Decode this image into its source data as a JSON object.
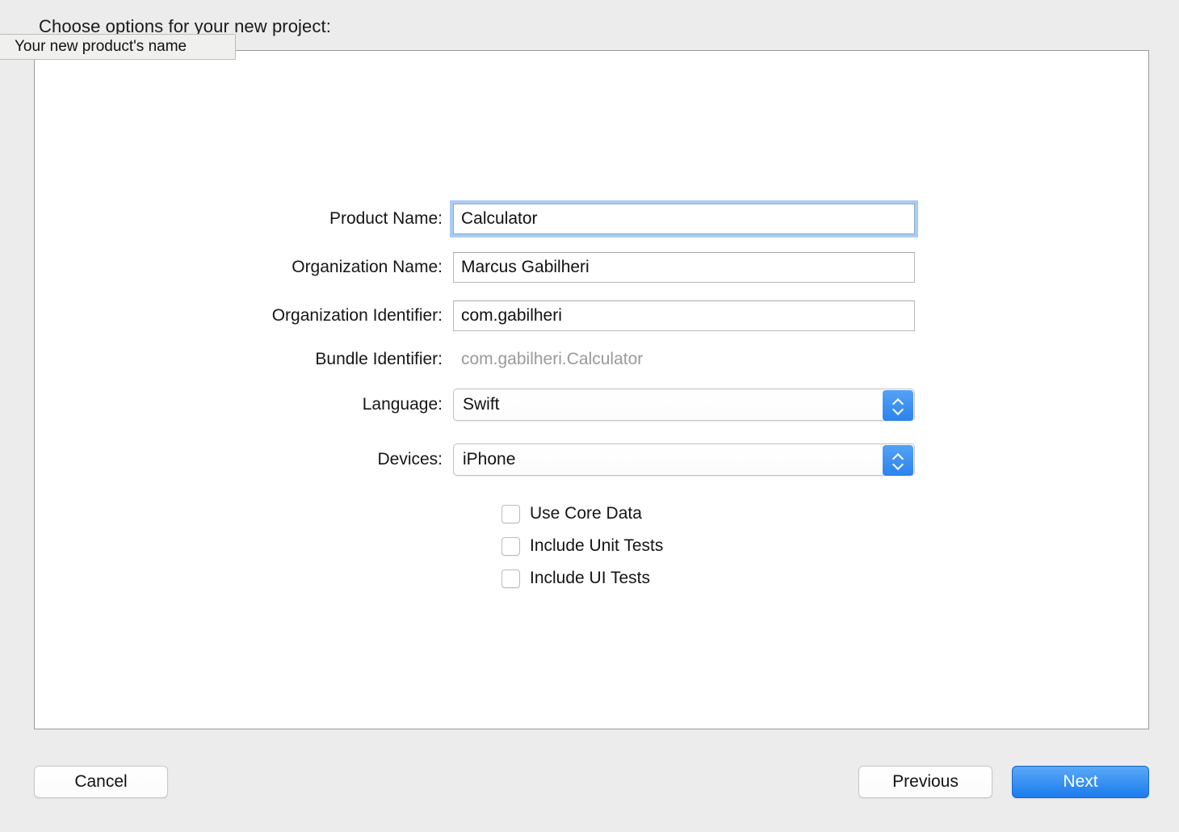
{
  "header": {
    "title": "Choose options for your new project:"
  },
  "tooltip": {
    "text": "Your new product's name"
  },
  "form": {
    "fields": [
      {
        "label": "Product Name:",
        "value": "Calculator",
        "type": "text",
        "focused": true
      },
      {
        "label": "Organization Name:",
        "value": "Marcus Gabilheri",
        "type": "text",
        "focused": false
      },
      {
        "label": "Organization Identifier:",
        "value": "com.gabilheri",
        "type": "text",
        "focused": false
      },
      {
        "label": "Bundle Identifier:",
        "value": "com.gabilheri.Calculator",
        "type": "static",
        "focused": false
      },
      {
        "label": "Language:",
        "value": "Swift",
        "type": "popup",
        "focused": false
      },
      {
        "label": "Devices:",
        "value": "iPhone",
        "type": "popup",
        "focused": false
      }
    ]
  },
  "checkboxes": [
    {
      "label": "Use Core Data",
      "checked": false
    },
    {
      "label": "Include Unit Tests",
      "checked": false
    },
    {
      "label": "Include UI Tests",
      "checked": false
    }
  ],
  "footer": {
    "cancel_label": "Cancel",
    "previous_label": "Previous",
    "next_label": "Next"
  },
  "colors": {
    "accent_blue": "#2b83ed",
    "focus_ring": "#78aeeb",
    "window_bg": "#ececec",
    "panel_bg": "#ffffff",
    "disabled_text": "#9a9a9a"
  }
}
